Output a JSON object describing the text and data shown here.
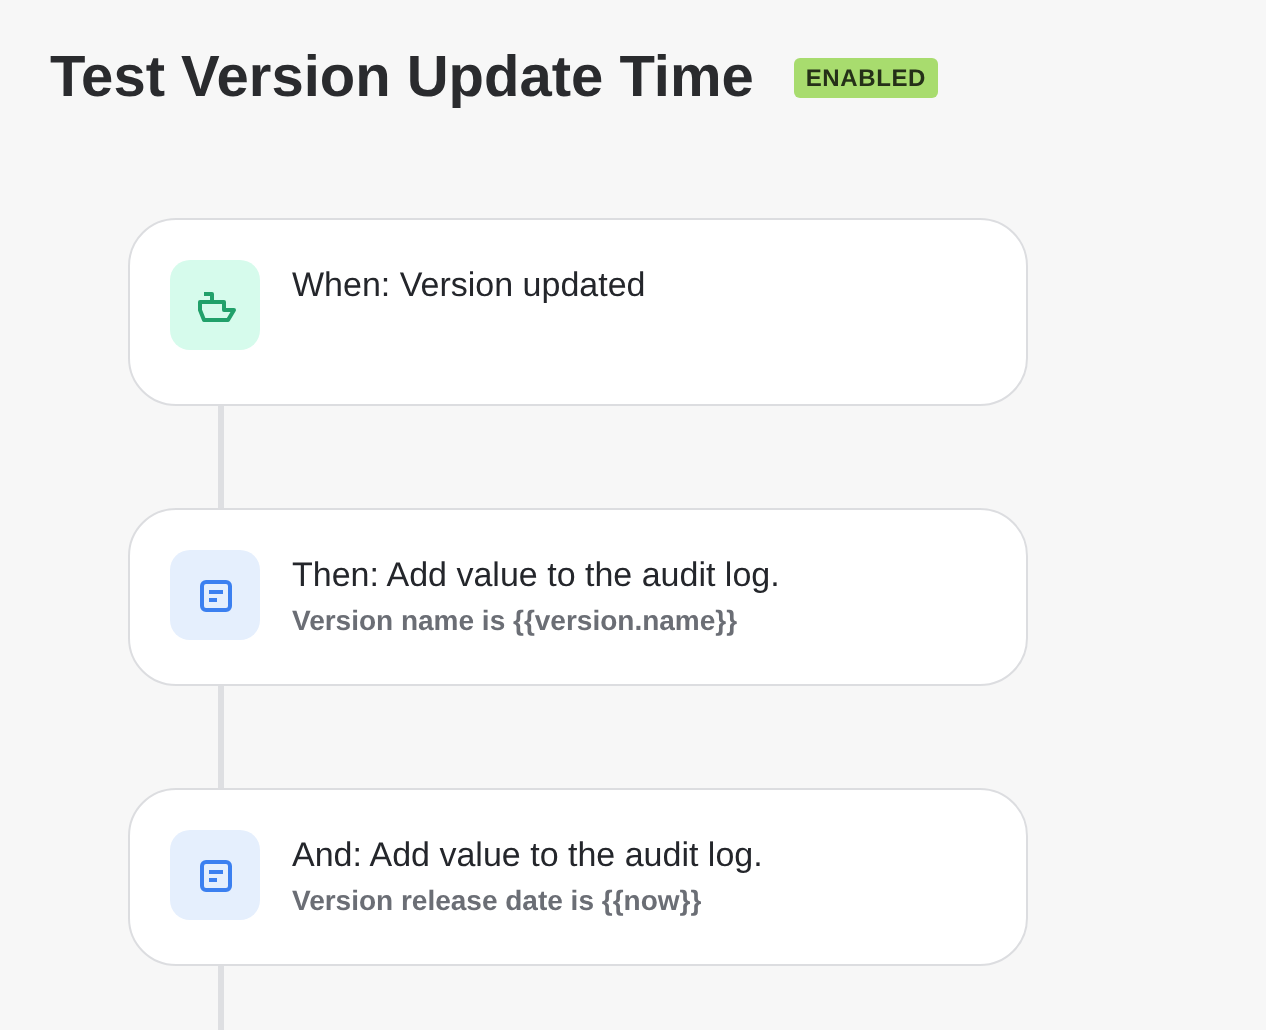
{
  "title": "Test Version Update Time",
  "status": {
    "label": "ENABLED",
    "enabled": true
  },
  "steps": [
    {
      "kind": "trigger",
      "title": "When: Version updated"
    },
    {
      "kind": "action",
      "title": "Then: Add value to the audit log.",
      "detail": "Version name is {{version.name}}"
    },
    {
      "kind": "action",
      "title": "And: Add value to the audit log.",
      "detail": "Version release date is {{now}}"
    }
  ]
}
